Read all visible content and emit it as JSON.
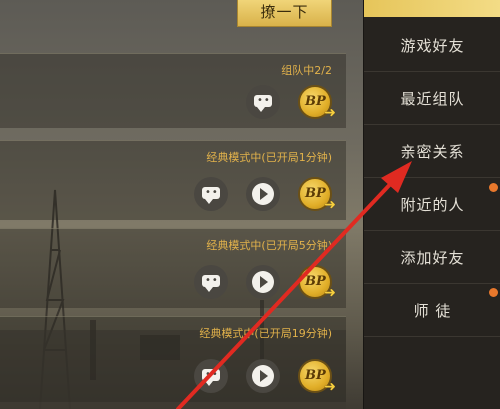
{
  "top_button": {
    "label": "撩一下"
  },
  "friends": [
    {
      "status": "组队中2/2",
      "buttons": [
        "chat-icon",
        "bp-icon"
      ]
    },
    {
      "status": "经典模式中(已开局1分钟)",
      "buttons": [
        "chat-icon",
        "play-icon",
        "bp-icon"
      ]
    },
    {
      "status": "经典模式中(已开局5分钟)",
      "buttons": [
        "chat-icon",
        "play-icon",
        "bp-icon"
      ]
    },
    {
      "status": "经典模式中(已开局19分钟)",
      "buttons": [
        "chat-icon",
        "play-icon",
        "bp-icon"
      ]
    }
  ],
  "sidebar": {
    "items": [
      {
        "label": "游戏好友"
      },
      {
        "label": "最近组队"
      },
      {
        "label": "亲密关系"
      },
      {
        "label": "附近的人",
        "badge": true
      },
      {
        "label": "添加好友"
      },
      {
        "label": "师 徒",
        "badge": true
      }
    ]
  },
  "colors": {
    "accent_gold": "#e2b24b",
    "badge_orange": "#e8782c",
    "annotation_red": "#e02a21"
  }
}
